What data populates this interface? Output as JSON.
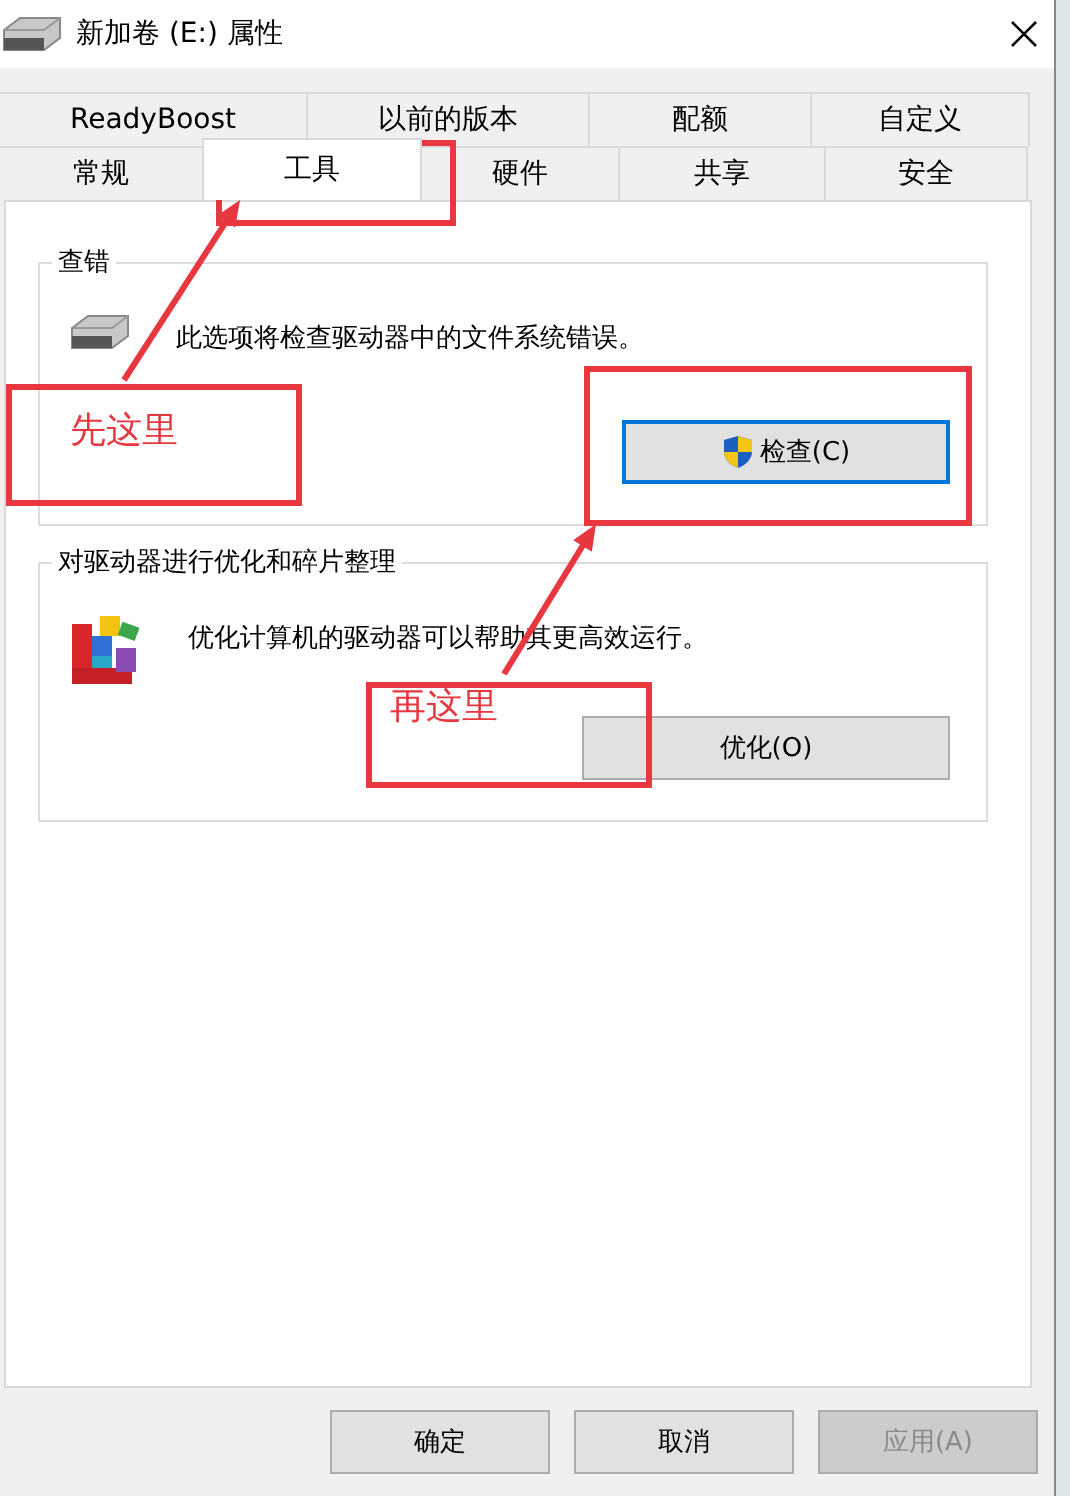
{
  "window": {
    "title": "新加卷 (E:) 属性"
  },
  "tab_rows": [
    {
      "tabs": [
        {
          "label": "ReadyBoost",
          "selected": false
        },
        {
          "label": "以前的版本",
          "selected": false
        },
        {
          "label": "配额",
          "selected": false
        },
        {
          "label": "自定义",
          "selected": false
        }
      ]
    },
    {
      "tabs": [
        {
          "label": "常规",
          "selected": false
        },
        {
          "label": "工具",
          "selected": true
        },
        {
          "label": "硬件",
          "selected": false
        },
        {
          "label": "共享",
          "selected": false
        },
        {
          "label": "安全",
          "selected": false
        }
      ]
    }
  ],
  "groups": [
    {
      "kind": "error-check",
      "title": "查错",
      "description": "此选项将检查驱动器中的文件系统错误。",
      "button": {
        "label": "检查(C)",
        "focused": true,
        "shield": true
      }
    },
    {
      "kind": "optimize",
      "title": "对驱动器进行优化和碎片整理",
      "description": "优化计算机的驱动器可以帮助其更高效运行。",
      "button": {
        "label": "优化(O)",
        "focused": false,
        "shield": false
      }
    }
  ],
  "buttons": [
    {
      "label": "确定",
      "disabled": false
    },
    {
      "label": "取消",
      "disabled": false
    },
    {
      "label": "应用(A)",
      "disabled": true
    }
  ],
  "annotations": [
    {
      "kind": "box"
    },
    {
      "kind": "arrow"
    },
    {
      "kind": "labeled-box",
      "label": "先这里"
    },
    {
      "kind": "box"
    },
    {
      "kind": "arrow"
    },
    {
      "kind": "labeled-box",
      "label": "再这里"
    }
  ]
}
